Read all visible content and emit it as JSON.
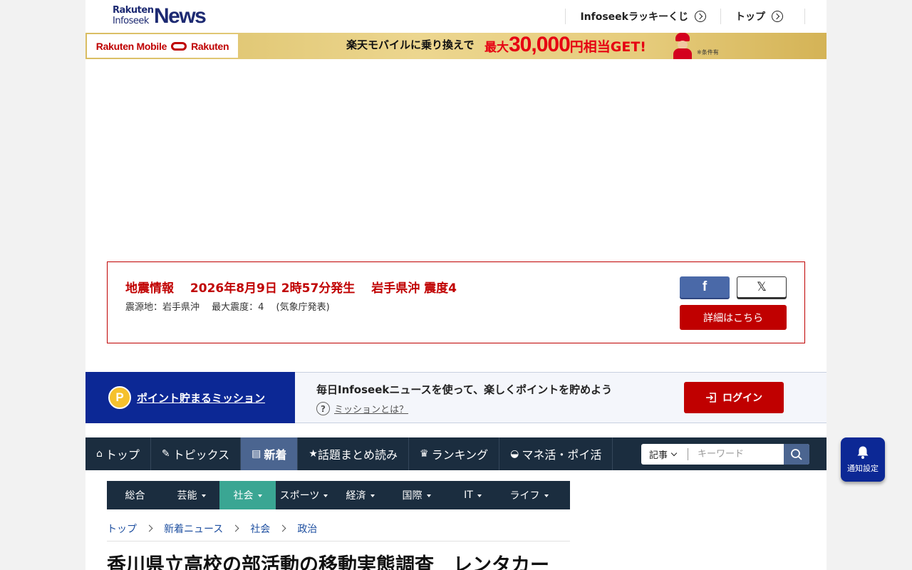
{
  "header": {
    "logo_rakuten": "Rakuten",
    "logo_infoseek": "Infoseek",
    "logo_news": "News",
    "nav": [
      {
        "label": "Infoseekラッキーくじ"
      },
      {
        "label": "トップ"
      }
    ]
  },
  "banner": {
    "brand_left": "Rakuten Mobile",
    "brand_right": "Rakuten",
    "text": "楽天モバイルに乗り換えで",
    "promo_prefix": "最大",
    "promo_amount": "30,000",
    "promo_suffix": "円相当GET!",
    "note": "※条件有"
  },
  "quake": {
    "title": "地震情報　 2026年8月9日 2時57分発生　 岩手県沖 震度4",
    "detail": "震源地：岩手県沖　 最大震度：4　 (気象庁発表)",
    "share_facebook": "f",
    "share_x": "𝕏",
    "more_label": "詳細はこちら"
  },
  "mission": {
    "coin_label": "P",
    "link_label": "ポイント貯まるミッション",
    "description": "毎日Infoseekニュースを使って、楽しくポイントを貯めよう",
    "help_icon": "?",
    "help_label": "ミッションとは？",
    "login_label": "ログイン"
  },
  "mainnav": {
    "items": [
      {
        "icon": "⌂",
        "label": "トップ"
      },
      {
        "icon": "✎",
        "label": "トピックス"
      },
      {
        "icon": "▤",
        "label": "新着"
      },
      {
        "icon": "★",
        "label": "話題まとめ読み"
      },
      {
        "icon": "♛",
        "label": "ランキング"
      },
      {
        "icon": "◒",
        "label": "マネ活・ポイ活"
      }
    ],
    "search": {
      "scope": "記事",
      "placeholder": "キーワード"
    }
  },
  "subnav": {
    "items": [
      {
        "label": "総合"
      },
      {
        "label": "芸能"
      },
      {
        "label": "社会"
      },
      {
        "label": "スポーツ"
      },
      {
        "label": "経済"
      },
      {
        "label": "国際"
      },
      {
        "label": "IT"
      },
      {
        "label": "ライフ"
      }
    ]
  },
  "breadcrumb": [
    {
      "label": "トップ"
    },
    {
      "label": "新着ニュース"
    },
    {
      "label": "社会"
    },
    {
      "label": "政治"
    }
  ],
  "article": {
    "title": "香川県立高校の部活動の移動実態調査　レンタカー"
  },
  "notify": {
    "label": "通知設定"
  },
  "colors": {
    "brand_blue": "#0c2895",
    "nav_dark": "#1b2d3f",
    "nav_active": "#4b6590",
    "subnav_active": "#3aa693",
    "alert_red": "#c00000"
  }
}
